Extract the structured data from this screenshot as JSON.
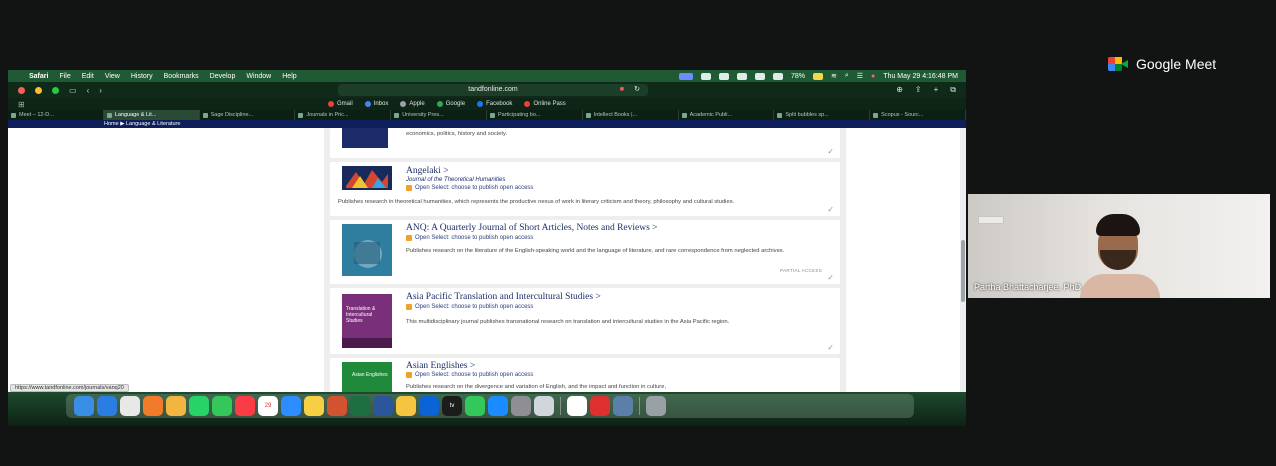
{
  "mac": {
    "menubar": {
      "app": "Safari",
      "items": [
        "File",
        "Edit",
        "View",
        "History",
        "Bookmarks",
        "Develop",
        "Window",
        "Help"
      ],
      "battery": "78%",
      "clock": "Thu May 29  4:16:48 PM"
    },
    "toolbar": {
      "address": "tandfonline.com"
    },
    "favorites": [
      {
        "label": "Gmail",
        "color": "#ea4335"
      },
      {
        "label": "Inbox",
        "color": "#4285f4"
      },
      {
        "label": "Apple",
        "color": "#9aa0a6"
      },
      {
        "label": "Google",
        "color": "#34a853"
      },
      {
        "label": "Facebook",
        "color": "#1877f2"
      },
      {
        "label": "Online Pass",
        "color": "#ea4335"
      }
    ],
    "tabs": [
      {
        "label": "Meet – 12-D...",
        "active": false
      },
      {
        "label": "Language & Lit...",
        "active": true
      },
      {
        "label": "Sage Discipline...",
        "active": false
      },
      {
        "label": "Journals in Pric...",
        "active": false
      },
      {
        "label": "University Pres...",
        "active": false
      },
      {
        "label": "Participating bo...",
        "active": false
      },
      {
        "label": "Intellect Books |...",
        "active": false
      },
      {
        "label": "Academic Publi...",
        "active": false
      },
      {
        "label": "Split bubbles sp...",
        "active": false
      },
      {
        "label": "Scopus - Sourc...",
        "active": false
      }
    ],
    "breadcrumb": "Home  ▶  Language & Literature",
    "journals": [
      {
        "title": "",
        "subtitle": "",
        "open_access": "",
        "description": "economics, politics, history and society.",
        "partial": "",
        "cover_color": "#1c2a6a"
      },
      {
        "title": "Angelaki  >",
        "subtitle": "Journal of the Theoretical Humanities",
        "open_access": "Open Select: choose to publish open access",
        "description": "Publishes research in theoretical humanities, which represents the productive nexus of work in literary criticism and theory, philosophy and cultural studies.",
        "partial": "",
        "cover_color": "#182a5c"
      },
      {
        "title": "ANQ: A Quarterly Journal of Short Articles, Notes and Reviews  >",
        "subtitle": "",
        "open_access": "Open Select: choose to publish open access",
        "description": "Publishes research on the literature of the English-speaking world and the language of literature, and rare correspondence from neglected archives.",
        "partial": "PARTIAL ACCESS",
        "cover_color": "#2f7ea0"
      },
      {
        "title": "Asia Pacific Translation and Intercultural Studies  >",
        "subtitle": "",
        "open_access": "Open Select: choose to publish open access",
        "description": "This multidisciplinary journal publishes transnational research on translation and intercultural studies in the Asia Pacific region.",
        "partial": "",
        "cover_color": "#7a2f7a",
        "cover_text": "Translation & Intercultural Studies"
      },
      {
        "title": "Asian Englishes  >",
        "subtitle": "",
        "open_access": "Open Select: choose to publish open access",
        "description": "Publishes research on the divergence and variation of English, and the impact and function in culture,",
        "partial": "",
        "cover_color": "#1f8a3a",
        "cover_text": "Asian Englishes"
      }
    ],
    "status_url": "https://www.tandfonline.com/journals/vanq20",
    "dock": [
      {
        "name": "finder-icon",
        "color": "#3a8ee6"
      },
      {
        "name": "safari-icon",
        "color": "#2a7de1"
      },
      {
        "name": "chrome-icon",
        "color": "#e8e8e8"
      },
      {
        "name": "firefox-icon",
        "color": "#f07b2b"
      },
      {
        "name": "photos-icon",
        "color": "#f2b640"
      },
      {
        "name": "whatsapp-icon",
        "color": "#25d366"
      },
      {
        "name": "messages-icon",
        "color": "#34c759"
      },
      {
        "name": "music-icon",
        "color": "#fc3c44"
      },
      {
        "name": "calendar-icon",
        "color": "#ffffff",
        "label": "29"
      },
      {
        "name": "zoom-icon",
        "color": "#2d8cff"
      },
      {
        "name": "notes-icon",
        "color": "#f6cf45"
      },
      {
        "name": "powerpoint-icon",
        "color": "#d35230"
      },
      {
        "name": "excel-icon",
        "color": "#1d6f42"
      },
      {
        "name": "word-icon",
        "color": "#2b579a"
      },
      {
        "name": "files-icon",
        "color": "#f5c542"
      },
      {
        "name": "outlook-icon",
        "color": "#0a64d6"
      },
      {
        "name": "appletv-icon",
        "color": "#1c1c1c",
        "label": "tv"
      },
      {
        "name": "facetime-icon",
        "color": "#34c759"
      },
      {
        "name": "appstore-icon",
        "color": "#1a8cff"
      },
      {
        "name": "settings-icon",
        "color": "#8e8e93"
      },
      {
        "name": "preview-icon",
        "color": "#d0d6dc"
      },
      {
        "name": "slack-icon",
        "color": "#ffffff"
      },
      {
        "name": "acrobat-icon",
        "color": "#e02f2f"
      },
      {
        "name": "screen-icon",
        "color": "#5a7fa8"
      },
      {
        "name": "trash-icon",
        "color": "#9aa1a6"
      }
    ]
  },
  "meet": {
    "brand": "Google Meet",
    "participant": "Partha Bhattacharjee, PhD"
  }
}
